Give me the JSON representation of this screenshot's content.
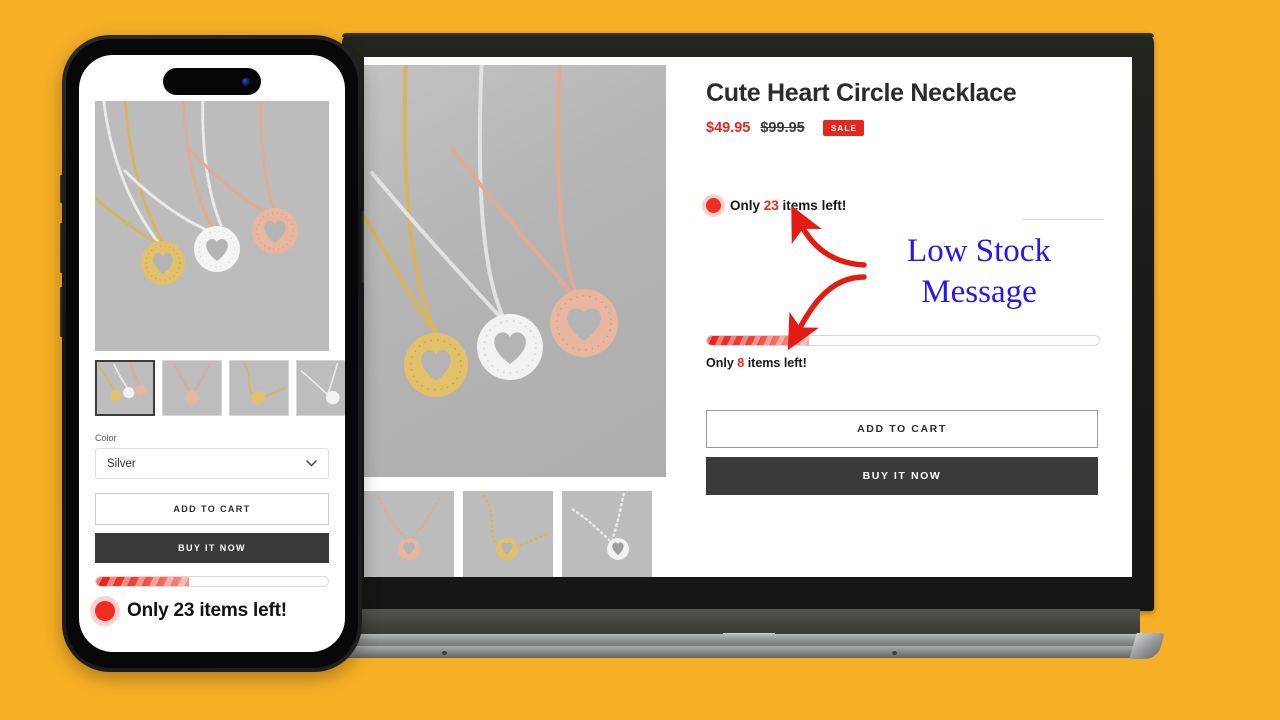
{
  "background": {
    "color": "#F7AF26"
  },
  "desktop": {
    "product": {
      "title": "Cute Heart Circle Necklace",
      "sale_price": "$49.95",
      "compare_price": "$99.95",
      "sale_badge": "SALE"
    },
    "stock_message": {
      "prefix": "Only ",
      "count": "23",
      "suffix": " items left!",
      "dot_color": "#F02D20",
      "count_color": "#E8271C"
    },
    "progress": {
      "percent": 26,
      "label_prefix": "Only ",
      "label_count": "8",
      "label_suffix": " items left!"
    },
    "buttons": {
      "add_to_cart": "ADD TO CART",
      "buy_it_now": "BUY IT NOW"
    }
  },
  "annotation": {
    "line1": "Low Stock",
    "line2": "Message",
    "text_color": "#2316F0",
    "arrow_color": "#E31B14"
  },
  "phone": {
    "variant_label": "Color",
    "variant_value": "Silver",
    "chevron": "chevron-down-icon",
    "buttons": {
      "add_to_cart": "ADD TO CART",
      "buy_it_now": "BUY IT NOW"
    },
    "progress": {
      "percent": 40
    },
    "stock_message": {
      "text": "Only 23 items left!",
      "dot_color": "#F02D20"
    }
  }
}
